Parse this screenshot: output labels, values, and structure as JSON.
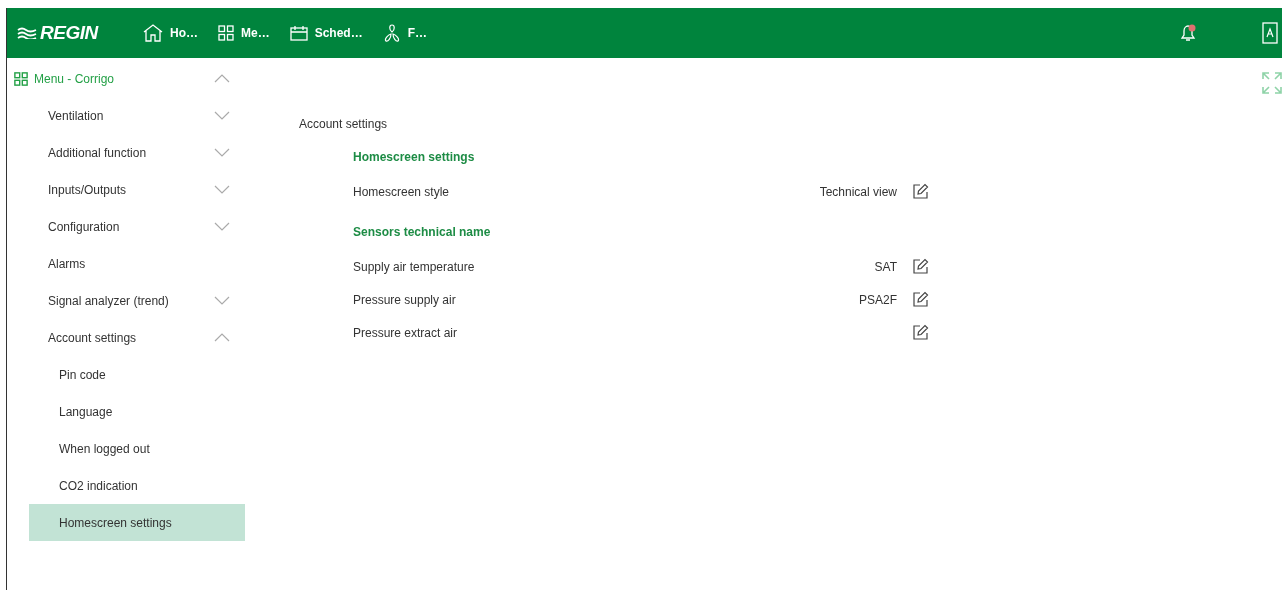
{
  "header": {
    "logo": "REGIN",
    "nav": [
      {
        "kind": "home",
        "label": "Ho…"
      },
      {
        "kind": "menu",
        "label": "Me…"
      },
      {
        "kind": "schedule",
        "label": "Sched…"
      },
      {
        "kind": "fan",
        "label": "F…"
      }
    ],
    "notifications": {
      "unread": true
    }
  },
  "sidebar": {
    "title": "Menu - Corrigo",
    "expanded": true,
    "items": [
      {
        "label": "Ventilation",
        "kind": "group",
        "expanded": false,
        "selected": false
      },
      {
        "label": "Additional function",
        "kind": "group",
        "expanded": false,
        "selected": false
      },
      {
        "label": "Inputs/Outputs",
        "kind": "group",
        "expanded": false,
        "selected": false
      },
      {
        "label": "Configuration",
        "kind": "group",
        "expanded": false,
        "selected": false
      },
      {
        "label": "Alarms",
        "kind": "leaf",
        "selected": false
      },
      {
        "label": "Signal analyzer (trend)",
        "kind": "group",
        "expanded": false,
        "selected": false
      },
      {
        "label": "Account settings",
        "kind": "group",
        "expanded": true,
        "selected": false,
        "children": [
          {
            "label": "Pin code",
            "selected": false
          },
          {
            "label": "Language",
            "selected": false
          },
          {
            "label": "When logged out",
            "selected": false
          },
          {
            "label": "CO2 indication",
            "selected": false
          },
          {
            "label": "Homescreen settings",
            "selected": true
          }
        ]
      }
    ]
  },
  "content": {
    "breadcrumb": "Account settings",
    "sections": [
      {
        "title": "Homescreen settings",
        "rows": [
          {
            "label": "Homescreen style",
            "value": "Technical view"
          }
        ]
      },
      {
        "title": "Sensors technical name",
        "rows": [
          {
            "label": "Supply air temperature",
            "value": "SAT"
          },
          {
            "label": "Pressure supply air",
            "value": "PSA2F"
          },
          {
            "label": "Pressure extract air"
          }
        ]
      }
    ]
  }
}
